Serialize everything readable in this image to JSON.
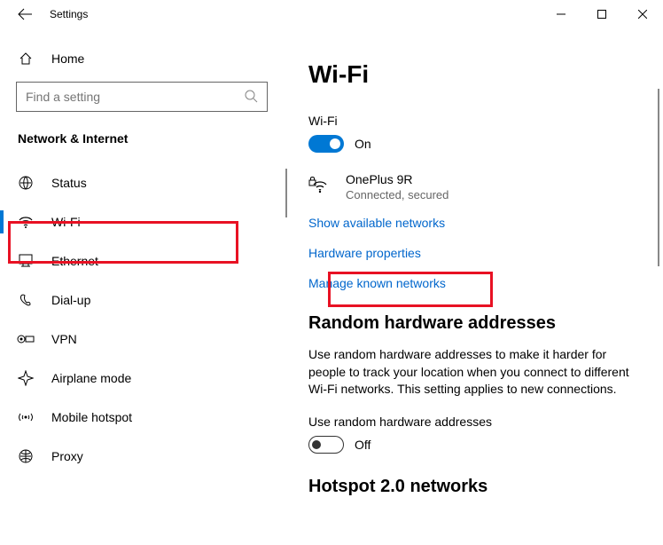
{
  "window": {
    "title": "Settings"
  },
  "sidebar": {
    "home": "Home",
    "search_placeholder": "Find a setting",
    "category": "Network & Internet",
    "items": [
      {
        "label": "Status"
      },
      {
        "label": "Wi-Fi"
      },
      {
        "label": "Ethernet"
      },
      {
        "label": "Dial-up"
      },
      {
        "label": "VPN"
      },
      {
        "label": "Airplane mode"
      },
      {
        "label": "Mobile hotspot"
      },
      {
        "label": "Proxy"
      }
    ]
  },
  "main": {
    "title": "Wi-Fi",
    "wifi_label": "Wi-Fi",
    "wifi_toggle": "On",
    "network": {
      "name": "OnePlus 9R",
      "status": "Connected, secured"
    },
    "links": {
      "show_available": "Show available networks",
      "hardware_props": "Hardware properties",
      "manage_known": "Manage known networks"
    },
    "random_hw": {
      "heading": "Random hardware addresses",
      "desc": "Use random hardware addresses to make it harder for people to track your location when you connect to different Wi-Fi networks. This setting applies to new connections.",
      "toggle_label": "Use random hardware addresses",
      "toggle_state": "Off"
    },
    "hotspot_heading": "Hotspot 2.0 networks"
  }
}
